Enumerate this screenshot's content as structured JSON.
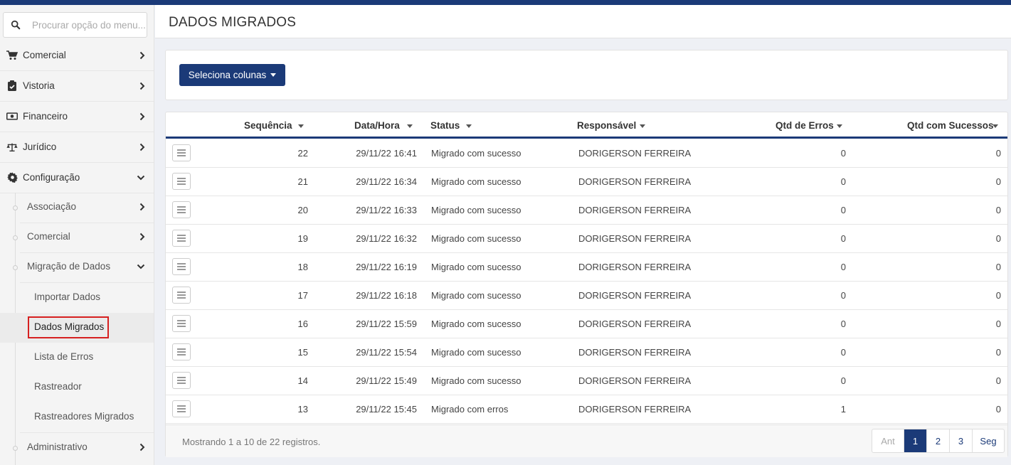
{
  "search": {
    "placeholder": "Procurar opção do menu..."
  },
  "sidebar": {
    "items": [
      {
        "label": "Comercial",
        "icon": "cart-icon"
      },
      {
        "label": "Vistoria",
        "icon": "clipboard-icon"
      },
      {
        "label": "Financeiro",
        "icon": "money-icon"
      },
      {
        "label": "Jurídico",
        "icon": "scale-icon"
      },
      {
        "label": "Configuração",
        "icon": "gear-icon"
      }
    ],
    "config_sub": [
      {
        "label": "Associação"
      },
      {
        "label": "Comercial"
      },
      {
        "label": "Migração de Dados"
      }
    ],
    "migracao_sub": [
      {
        "label": "Importar Dados"
      },
      {
        "label": "Dados Migrados"
      },
      {
        "label": "Lista de Erros"
      },
      {
        "label": "Rastreador"
      },
      {
        "label": "Rastreadores Migrados"
      }
    ],
    "admin": {
      "label": "Administrativo"
    }
  },
  "page": {
    "title": "DADOS MIGRADOS"
  },
  "toolbar": {
    "select_columns_label": "Seleciona colunas"
  },
  "table": {
    "columns": {
      "sequencia": "Sequência",
      "datahora": "Data/Hora",
      "status": "Status",
      "responsavel": "Responsável",
      "erros": "Qtd de Erros",
      "sucessos": "Qtd com Sucessos"
    },
    "rows": [
      {
        "seq": "22",
        "datahora": "29/11/22 16:41",
        "status": "Migrado com sucesso",
        "responsavel": "DORIGERSON FERREIRA",
        "erros": "0",
        "sucessos": "0"
      },
      {
        "seq": "21",
        "datahora": "29/11/22 16:34",
        "status": "Migrado com sucesso",
        "responsavel": "DORIGERSON FERREIRA",
        "erros": "0",
        "sucessos": "0"
      },
      {
        "seq": "20",
        "datahora": "29/11/22 16:33",
        "status": "Migrado com sucesso",
        "responsavel": "DORIGERSON FERREIRA",
        "erros": "0",
        "sucessos": "0"
      },
      {
        "seq": "19",
        "datahora": "29/11/22 16:32",
        "status": "Migrado com sucesso",
        "responsavel": "DORIGERSON FERREIRA",
        "erros": "0",
        "sucessos": "0"
      },
      {
        "seq": "18",
        "datahora": "29/11/22 16:19",
        "status": "Migrado com sucesso",
        "responsavel": "DORIGERSON FERREIRA",
        "erros": "0",
        "sucessos": "0"
      },
      {
        "seq": "17",
        "datahora": "29/11/22 16:18",
        "status": "Migrado com sucesso",
        "responsavel": "DORIGERSON FERREIRA",
        "erros": "0",
        "sucessos": "0"
      },
      {
        "seq": "16",
        "datahora": "29/11/22 15:59",
        "status": "Migrado com sucesso",
        "responsavel": "DORIGERSON FERREIRA",
        "erros": "0",
        "sucessos": "0"
      },
      {
        "seq": "15",
        "datahora": "29/11/22 15:54",
        "status": "Migrado com sucesso",
        "responsavel": "DORIGERSON FERREIRA",
        "erros": "0",
        "sucessos": "0"
      },
      {
        "seq": "14",
        "datahora": "29/11/22 15:49",
        "status": "Migrado com sucesso",
        "responsavel": "DORIGERSON FERREIRA",
        "erros": "0",
        "sucessos": "0"
      },
      {
        "seq": "13",
        "datahora": "29/11/22 15:45",
        "status": "Migrado com erros",
        "responsavel": "DORIGERSON FERREIRA",
        "erros": "1",
        "sucessos": "0"
      }
    ]
  },
  "footer": {
    "info": "Mostrando 1 a 10 de 22 registros.",
    "pager": {
      "prev": "Ant",
      "pages": [
        "1",
        "2",
        "3"
      ],
      "next": "Seg",
      "current": "1"
    }
  },
  "colors": {
    "primary": "#1b3a78",
    "highlight": "#d62020"
  }
}
